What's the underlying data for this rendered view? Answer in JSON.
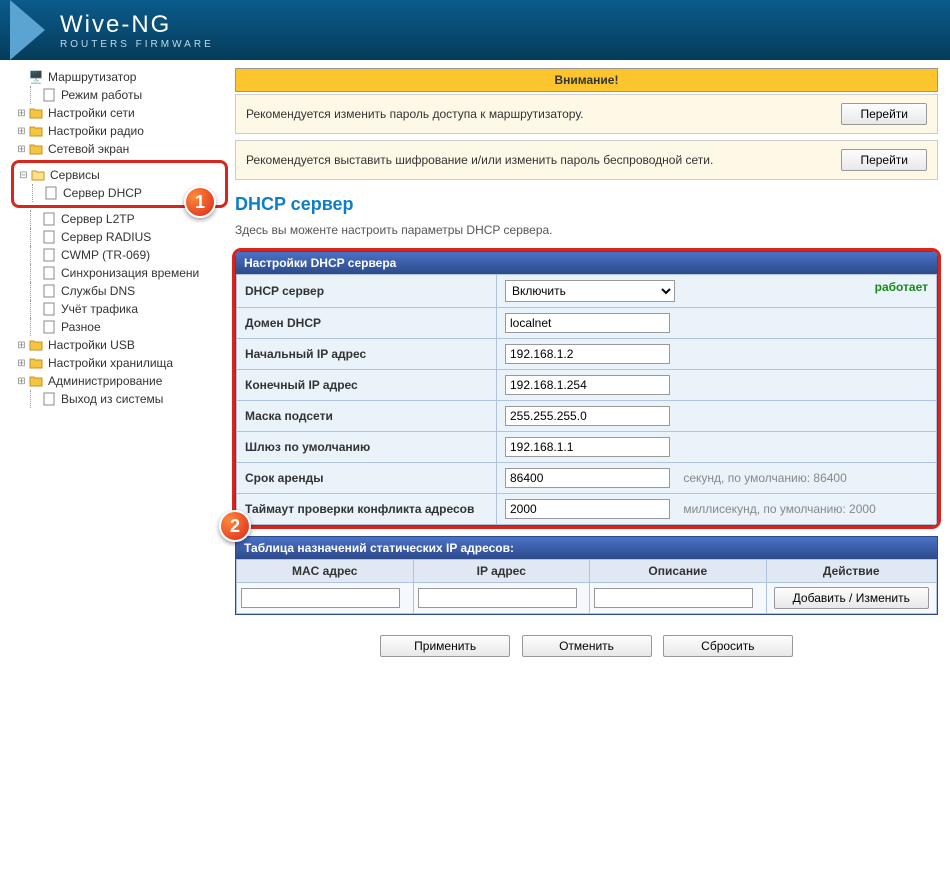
{
  "brand": {
    "name": "Wive-NG",
    "tagline": "ROUTERS FIRMWARE"
  },
  "nav": {
    "router": "Маршрутизатор",
    "opmode": "Режим работы",
    "netset": "Настройки сети",
    "radioset": "Настройки радио",
    "firewall": "Сетевой экран",
    "services": "Сервисы",
    "svc": {
      "dhcp": "Сервер DHCP",
      "l2tp": "Сервер L2TP",
      "radius": "Сервер RADIUS",
      "cwmp": "CWMP (TR-069)",
      "ntp": "Синхронизация времени",
      "dns": "Службы DNS",
      "traffic": "Учёт трафика",
      "misc": "Разное"
    },
    "usb": "Настройки USB",
    "storage": "Настройки хранилища",
    "admin": "Администрирование",
    "logout": "Выход из системы"
  },
  "alerts": {
    "title": "Внимание!",
    "pw": "Рекомендуется изменить пароль доступа к маршрутизатору.",
    "wifi": "Рекомендуется выставить шифрование и/или изменить пароль беспроводной сети.",
    "go": "Перейти"
  },
  "page": {
    "title": "DHCP сервер",
    "desc": "Здесь вы моженте настроить параметры DHCP сервера."
  },
  "dhcp": {
    "panel_title": "Настройки DHCP сервера",
    "rows": {
      "server": "DHCP сервер",
      "domain": "Домен DHCP",
      "start": "Начальный IP адрес",
      "end": "Конечный IP адрес",
      "mask": "Маска подсети",
      "gw": "Шлюз по умолчанию",
      "lease": "Срок аренды",
      "conflict": "Таймаут проверки конфликта адресов"
    },
    "vals": {
      "enable_opt": "Включить",
      "domain": "localnet",
      "start": "192.168.1.2",
      "end": "192.168.1.254",
      "mask": "255.255.255.0",
      "gw": "192.168.1.1",
      "lease": "86400",
      "conflict": "2000"
    },
    "hints": {
      "lease": "секунд, по умолчанию: 86400",
      "conflict": "миллисекунд, по умолчанию: 2000"
    },
    "status": "работает"
  },
  "static": {
    "title": "Таблица назначений статических IP адресов:",
    "cols": {
      "mac": "MAC адрес",
      "ip": "IP адрес",
      "desc": "Описание",
      "action": "Действие"
    },
    "add_btn": "Добавить / Изменить"
  },
  "actions": {
    "apply": "Применить",
    "cancel": "Отменить",
    "reset": "Сбросить"
  },
  "markers": {
    "one": "1",
    "two": "2"
  }
}
